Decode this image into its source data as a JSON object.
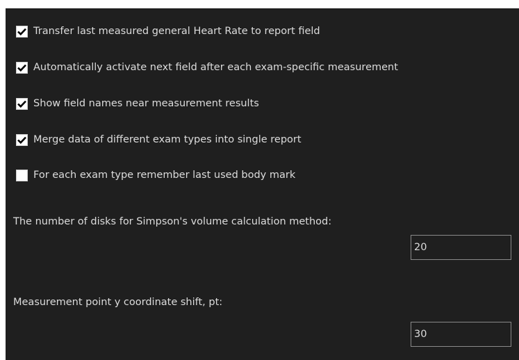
{
  "options": [
    {
      "label": "Transfer last measured general Heart Rate to report field",
      "checked": true
    },
    {
      "label": "Automatically activate next field after each exam-specific measurement",
      "checked": true
    },
    {
      "label": "Show field names near measurement results",
      "checked": true
    },
    {
      "label": "Merge data of different exam types into single report",
      "checked": true
    },
    {
      "label": "For each exam type remember last used body mark",
      "checked": false
    }
  ],
  "simpson": {
    "label": "The number of disks for Simpson's volume calculation method:",
    "value": "20"
  },
  "shift": {
    "label": "Measurement point y coordinate shift, pt:",
    "value": "30"
  },
  "icons": {
    "checkmark": "check-icon"
  },
  "colors": {
    "panel_background": "#1f1f1f",
    "text": "#dcdcdc",
    "checkbox_fill": "#ffffff",
    "checkmark": "#000000"
  }
}
